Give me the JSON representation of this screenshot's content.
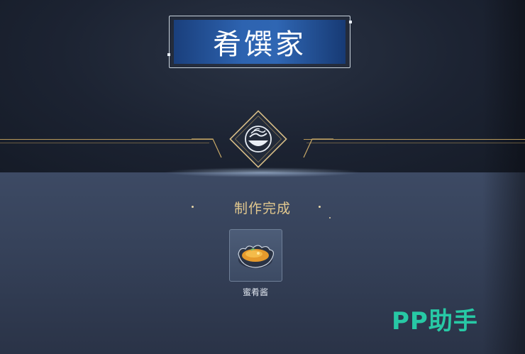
{
  "header": {
    "title": "肴馔家"
  },
  "result": {
    "status": "制作完成"
  },
  "reward": {
    "item_name": "蜜肴酱"
  },
  "watermark": {
    "text": "PP助手"
  },
  "icons": {
    "emblem": "cooking-bowl-emblem-icon",
    "item": "sauce-bowl-icon"
  },
  "colors": {
    "banner_blue": "#2d63b0",
    "gold_text": "#e3c98f",
    "panel": "#3d4a64",
    "watermark": "#27c9a5"
  }
}
